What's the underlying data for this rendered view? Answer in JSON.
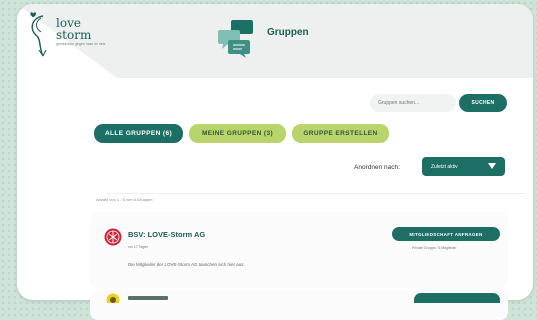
{
  "app": {
    "logo_line1": "love",
    "logo_line2": "storm",
    "logo_sub": "gemeinsam gegen hass im netz",
    "page_title": "Gruppen"
  },
  "search": {
    "placeholder": "Gruppen suchen...",
    "button_label": "SUCHEN"
  },
  "tabs": [
    {
      "label": "ALLE GRUPPEN (6)",
      "active": true
    },
    {
      "label": "MEINE GRUPPEN (3)",
      "active": false
    },
    {
      "label": "GRUPPE ERSTELLEN",
      "active": false
    }
  ],
  "sort": {
    "label": "Anordnen nach:",
    "selected": "Zuletzt aktiv"
  },
  "results": {
    "count_text": "Anzahl von 1 - 6 von 6 Gruppen"
  },
  "groups": [
    {
      "name": "BSV: LOVE-Storm AG",
      "meta": "vor 17 Tagen",
      "description": "Die Mitglieder der LOVE-Storm AG tauschen sich hier aus.",
      "action_label": "MITGLIEDSCHAFT ANFRAGEN",
      "info": "Private Gruppe / 6 Mitglieder",
      "avatar_icon": "red-shield-icon"
    },
    {
      "avatar_icon": "yellow-badge-icon"
    }
  ],
  "colors": {
    "primary": "#1d6f66",
    "accent": "#b8d46a",
    "background": "#cfe4d8"
  }
}
